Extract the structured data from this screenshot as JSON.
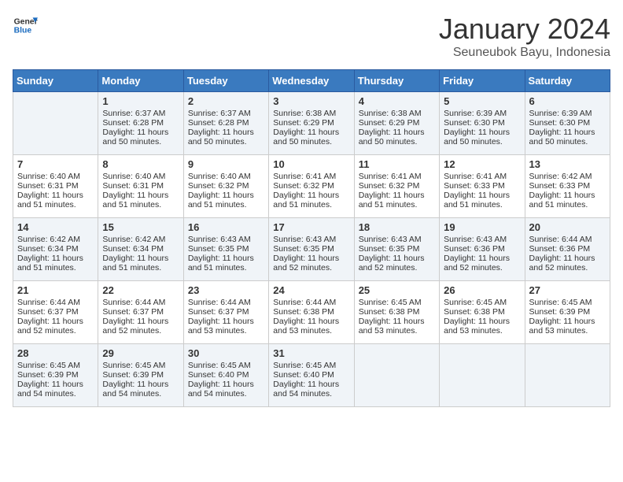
{
  "logo": {
    "text_general": "General",
    "text_blue": "Blue"
  },
  "header": {
    "title": "January 2024",
    "subtitle": "Seuneubok Bayu, Indonesia"
  },
  "days_of_week": [
    "Sunday",
    "Monday",
    "Tuesday",
    "Wednesday",
    "Thursday",
    "Friday",
    "Saturday"
  ],
  "weeks": [
    [
      {
        "day": "",
        "sunrise": "",
        "sunset": "",
        "daylight": ""
      },
      {
        "day": "1",
        "sunrise": "Sunrise: 6:37 AM",
        "sunset": "Sunset: 6:28 PM",
        "daylight": "Daylight: 11 hours and 50 minutes."
      },
      {
        "day": "2",
        "sunrise": "Sunrise: 6:37 AM",
        "sunset": "Sunset: 6:28 PM",
        "daylight": "Daylight: 11 hours and 50 minutes."
      },
      {
        "day": "3",
        "sunrise": "Sunrise: 6:38 AM",
        "sunset": "Sunset: 6:29 PM",
        "daylight": "Daylight: 11 hours and 50 minutes."
      },
      {
        "day": "4",
        "sunrise": "Sunrise: 6:38 AM",
        "sunset": "Sunset: 6:29 PM",
        "daylight": "Daylight: 11 hours and 50 minutes."
      },
      {
        "day": "5",
        "sunrise": "Sunrise: 6:39 AM",
        "sunset": "Sunset: 6:30 PM",
        "daylight": "Daylight: 11 hours and 50 minutes."
      },
      {
        "day": "6",
        "sunrise": "Sunrise: 6:39 AM",
        "sunset": "Sunset: 6:30 PM",
        "daylight": "Daylight: 11 hours and 50 minutes."
      }
    ],
    [
      {
        "day": "7",
        "sunrise": "Sunrise: 6:40 AM",
        "sunset": "Sunset: 6:31 PM",
        "daylight": "Daylight: 11 hours and 51 minutes."
      },
      {
        "day": "8",
        "sunrise": "Sunrise: 6:40 AM",
        "sunset": "Sunset: 6:31 PM",
        "daylight": "Daylight: 11 hours and 51 minutes."
      },
      {
        "day": "9",
        "sunrise": "Sunrise: 6:40 AM",
        "sunset": "Sunset: 6:32 PM",
        "daylight": "Daylight: 11 hours and 51 minutes."
      },
      {
        "day": "10",
        "sunrise": "Sunrise: 6:41 AM",
        "sunset": "Sunset: 6:32 PM",
        "daylight": "Daylight: 11 hours and 51 minutes."
      },
      {
        "day": "11",
        "sunrise": "Sunrise: 6:41 AM",
        "sunset": "Sunset: 6:32 PM",
        "daylight": "Daylight: 11 hours and 51 minutes."
      },
      {
        "day": "12",
        "sunrise": "Sunrise: 6:41 AM",
        "sunset": "Sunset: 6:33 PM",
        "daylight": "Daylight: 11 hours and 51 minutes."
      },
      {
        "day": "13",
        "sunrise": "Sunrise: 6:42 AM",
        "sunset": "Sunset: 6:33 PM",
        "daylight": "Daylight: 11 hours and 51 minutes."
      }
    ],
    [
      {
        "day": "14",
        "sunrise": "Sunrise: 6:42 AM",
        "sunset": "Sunset: 6:34 PM",
        "daylight": "Daylight: 11 hours and 51 minutes."
      },
      {
        "day": "15",
        "sunrise": "Sunrise: 6:42 AM",
        "sunset": "Sunset: 6:34 PM",
        "daylight": "Daylight: 11 hours and 51 minutes."
      },
      {
        "day": "16",
        "sunrise": "Sunrise: 6:43 AM",
        "sunset": "Sunset: 6:35 PM",
        "daylight": "Daylight: 11 hours and 51 minutes."
      },
      {
        "day": "17",
        "sunrise": "Sunrise: 6:43 AM",
        "sunset": "Sunset: 6:35 PM",
        "daylight": "Daylight: 11 hours and 52 minutes."
      },
      {
        "day": "18",
        "sunrise": "Sunrise: 6:43 AM",
        "sunset": "Sunset: 6:35 PM",
        "daylight": "Daylight: 11 hours and 52 minutes."
      },
      {
        "day": "19",
        "sunrise": "Sunrise: 6:43 AM",
        "sunset": "Sunset: 6:36 PM",
        "daylight": "Daylight: 11 hours and 52 minutes."
      },
      {
        "day": "20",
        "sunrise": "Sunrise: 6:44 AM",
        "sunset": "Sunset: 6:36 PM",
        "daylight": "Daylight: 11 hours and 52 minutes."
      }
    ],
    [
      {
        "day": "21",
        "sunrise": "Sunrise: 6:44 AM",
        "sunset": "Sunset: 6:37 PM",
        "daylight": "Daylight: 11 hours and 52 minutes."
      },
      {
        "day": "22",
        "sunrise": "Sunrise: 6:44 AM",
        "sunset": "Sunset: 6:37 PM",
        "daylight": "Daylight: 11 hours and 52 minutes."
      },
      {
        "day": "23",
        "sunrise": "Sunrise: 6:44 AM",
        "sunset": "Sunset: 6:37 PM",
        "daylight": "Daylight: 11 hours and 53 minutes."
      },
      {
        "day": "24",
        "sunrise": "Sunrise: 6:44 AM",
        "sunset": "Sunset: 6:38 PM",
        "daylight": "Daylight: 11 hours and 53 minutes."
      },
      {
        "day": "25",
        "sunrise": "Sunrise: 6:45 AM",
        "sunset": "Sunset: 6:38 PM",
        "daylight": "Daylight: 11 hours and 53 minutes."
      },
      {
        "day": "26",
        "sunrise": "Sunrise: 6:45 AM",
        "sunset": "Sunset: 6:38 PM",
        "daylight": "Daylight: 11 hours and 53 minutes."
      },
      {
        "day": "27",
        "sunrise": "Sunrise: 6:45 AM",
        "sunset": "Sunset: 6:39 PM",
        "daylight": "Daylight: 11 hours and 53 minutes."
      }
    ],
    [
      {
        "day": "28",
        "sunrise": "Sunrise: 6:45 AM",
        "sunset": "Sunset: 6:39 PM",
        "daylight": "Daylight: 11 hours and 54 minutes."
      },
      {
        "day": "29",
        "sunrise": "Sunrise: 6:45 AM",
        "sunset": "Sunset: 6:39 PM",
        "daylight": "Daylight: 11 hours and 54 minutes."
      },
      {
        "day": "30",
        "sunrise": "Sunrise: 6:45 AM",
        "sunset": "Sunset: 6:40 PM",
        "daylight": "Daylight: 11 hours and 54 minutes."
      },
      {
        "day": "31",
        "sunrise": "Sunrise: 6:45 AM",
        "sunset": "Sunset: 6:40 PM",
        "daylight": "Daylight: 11 hours and 54 minutes."
      },
      {
        "day": "",
        "sunrise": "",
        "sunset": "",
        "daylight": ""
      },
      {
        "day": "",
        "sunrise": "",
        "sunset": "",
        "daylight": ""
      },
      {
        "day": "",
        "sunrise": "",
        "sunset": "",
        "daylight": ""
      }
    ]
  ]
}
